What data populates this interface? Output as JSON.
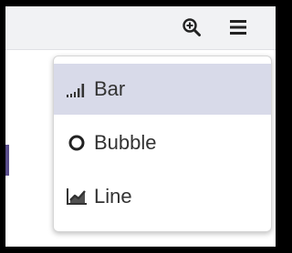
{
  "toolbar": {
    "zoom_icon": "zoom-in-icon",
    "menu_icon": "hamburger-menu-icon"
  },
  "colors": {
    "toolbar_bg": "#f1f2f4",
    "selected_item_bg": "#d8dae9",
    "text": "#333333",
    "accent": "#5a4e8c"
  },
  "menu": {
    "items": [
      {
        "label": "Bar",
        "icon": "bar-chart-icon",
        "selected": true
      },
      {
        "label": "Bubble",
        "icon": "bubble-circle-icon",
        "selected": false
      },
      {
        "label": "Line",
        "icon": "line-chart-icon",
        "selected": false
      }
    ]
  }
}
